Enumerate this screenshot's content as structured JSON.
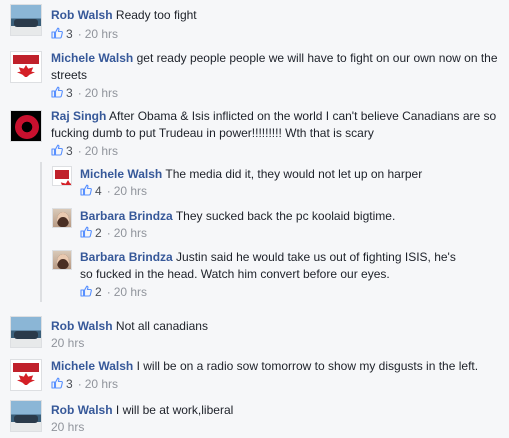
{
  "comments": [
    {
      "author": "Rob Walsh",
      "text": "Ready too fight",
      "likes": "3",
      "time": "20 hrs",
      "avatar": "car-avatar"
    },
    {
      "author": "Michele Walsh",
      "text": "get ready people people we will have to fight on our own now on the streets",
      "likes": "3",
      "time": "20 hrs",
      "avatar": "flag-avatar"
    },
    {
      "author": "Raj Singh",
      "text": "After Obama & Isis inflicted on the world I can't believe Canadians are so fucking dumb to put Trudeau in power!!!!!!!!! Wth that is scary",
      "likes": "3",
      "time": "20 hrs",
      "avatar": "red-circle-avatar"
    }
  ],
  "replies": [
    {
      "author": "Michele Walsh",
      "text": "The media did it, they would not let up on harper",
      "likes": "4",
      "time": "20 hrs",
      "avatar": "flag-avatar"
    },
    {
      "author": "Barbara Brindza",
      "text": "They sucked back the pc koolaid bigtime.",
      "likes": "2",
      "time": "20 hrs",
      "avatar": "woman-avatar"
    },
    {
      "author": "Barbara Brindza",
      "text": "Justin said he would take us out of fighting ISIS, he's so fucked in the head. Watch him convert before our eyes.",
      "likes": "2",
      "time": "20 hrs",
      "avatar": "woman-avatar"
    }
  ],
  "later": [
    {
      "author": "Rob Walsh",
      "text": "Not all canadians",
      "time": "20 hrs",
      "avatar": "car-avatar"
    },
    {
      "author": "Michele Walsh",
      "text": "I will be on a radio sow tomorrow to show my disgusts in the left.",
      "likes": "3",
      "time": "20 hrs",
      "avatar": "flag-avatar"
    },
    {
      "author": "Rob Walsh",
      "text": "I will be at work,liberal",
      "time": "20 hrs",
      "avatar": "car-avatar"
    }
  ],
  "colors": {
    "author": "#365899",
    "meta": "#90949c",
    "like": "#5890ff"
  }
}
